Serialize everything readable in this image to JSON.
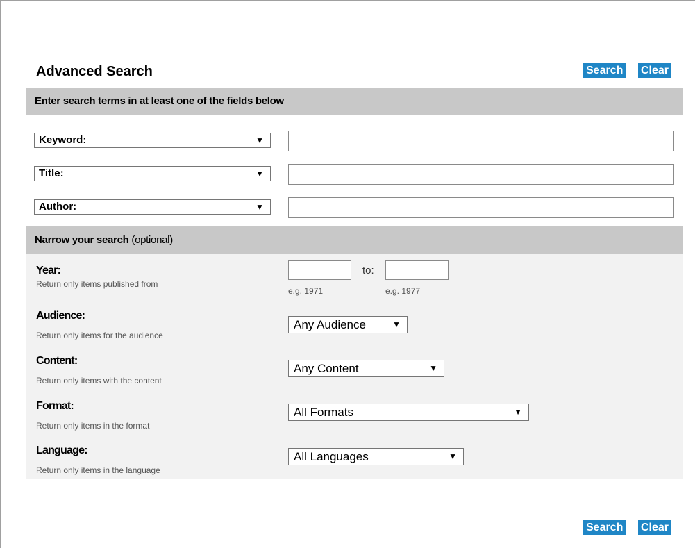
{
  "header": {
    "title": "Advanced Search",
    "search_label": "Search",
    "clear_label": "Clear"
  },
  "search_terms": {
    "heading": "Enter search terms in at least one of the fields below",
    "rows": [
      {
        "field": "Keyword:",
        "value": ""
      },
      {
        "field": "Title:",
        "value": ""
      },
      {
        "field": "Author:",
        "value": ""
      }
    ]
  },
  "narrow": {
    "heading": "Narrow your search",
    "heading_note": "(optional)",
    "year": {
      "label": "Year:",
      "help": "Return only items published from",
      "to_label": "to:",
      "from_example": "e.g. 1971",
      "to_example": "e.g. 1977"
    },
    "audience": {
      "label": "Audience:",
      "help": "Return only items for the audience",
      "selected": "Any Audience"
    },
    "content": {
      "label": "Content:",
      "help": "Return only items with the content",
      "selected": "Any Content"
    },
    "format": {
      "label": "Format:",
      "help": "Return only items in the format",
      "selected": "All Formats"
    },
    "language": {
      "label": "Language:",
      "help": "Return only items in the language",
      "selected": "All Languages"
    }
  },
  "footer": {
    "search_label": "Search",
    "clear_label": "Clear"
  },
  "colors": {
    "button": "#1f86c6",
    "band": "#c8c8c8",
    "narrow_bg": "#f2f2f2"
  },
  "icons": {
    "dropdown": "caret-down-icon"
  }
}
